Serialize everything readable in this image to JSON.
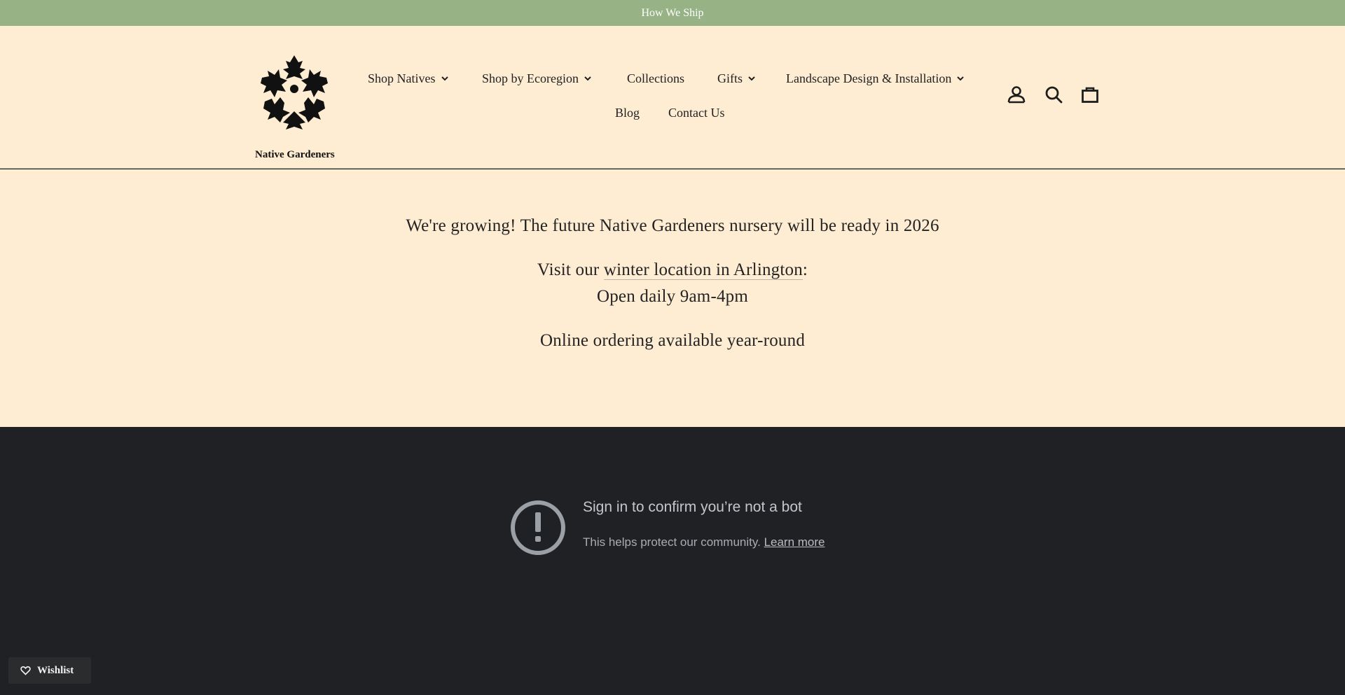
{
  "announcement": {
    "text": "How We Ship"
  },
  "brand": {
    "logo_text": "Native Gardeners"
  },
  "nav": {
    "shop_natives": "Shop Natives",
    "shop_by_ecoregion": "Shop by Ecoregion",
    "collections": "Collections",
    "gifts": "Gifts",
    "landscape": "Landscape Design & Installation",
    "blog": "Blog",
    "contact": "Contact Us"
  },
  "header_icons": [
    "account-icon",
    "search-icon",
    "cart-icon"
  ],
  "hero": {
    "line1": "We're growing! The future Native Gardeners nursery will be ready in 2026",
    "visit_prefix": "Visit our ",
    "visit_link": "winter location in Arlington",
    "visit_suffix": ":",
    "hours": "Open daily 9am-4pm",
    "online": "Online ordering available year-round"
  },
  "bot_notice": {
    "title": "Sign in to confirm you’re not a bot",
    "body": "This helps protect our community. ",
    "learn_more": "Learn more"
  },
  "wishlist": {
    "label": "Wishlist"
  },
  "colors": {
    "announcement_bg": "#97b386",
    "header_bg": "#ffedd3",
    "dark_bg": "#202124",
    "wishlist_bg": "#2b2c2e"
  }
}
